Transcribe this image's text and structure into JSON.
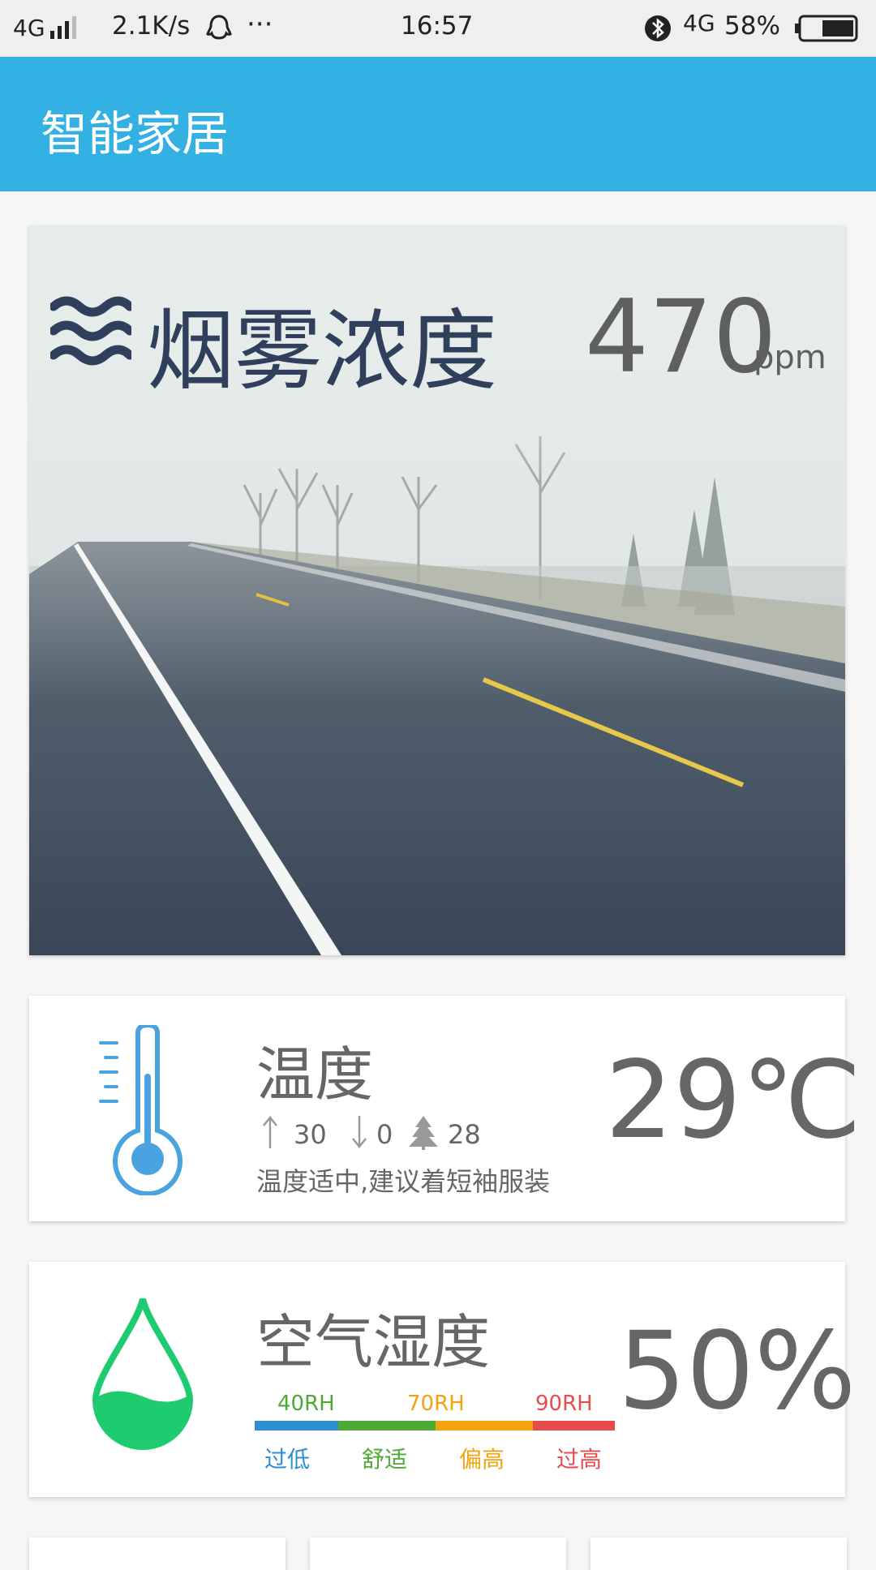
{
  "status_bar": {
    "network": "4G",
    "speed": "2.1K/s",
    "dots": "···",
    "time": "16:57",
    "network2": "4G",
    "battery": "58%"
  },
  "app_bar": {
    "title": "智能家居"
  },
  "smoke": {
    "label": "烟雾浓度",
    "value": "470",
    "unit": "ppm",
    "icon": "smoke-waves-icon"
  },
  "temperature": {
    "label": "温度",
    "value": "29℃",
    "high": "30",
    "low": "0",
    "tree_value": "28",
    "advice": "温度适中,建议着短袖服装",
    "icon": "thermometer-icon",
    "colors": {
      "icon": "#4aa3e0"
    }
  },
  "humidity": {
    "label": "空气湿度",
    "value": "50%",
    "icon": "water-drop-icon",
    "scale_top": [
      "40RH",
      "70RH",
      "90RH"
    ],
    "scale_bottom": [
      "过低",
      "舒适",
      "偏高",
      "过高"
    ],
    "colors": {
      "low": "#2c8fd0",
      "comfortable": "#4eaa34",
      "high": "#f2a30f",
      "too_high": "#e74c4c",
      "drop": "#1ecb6f"
    }
  }
}
